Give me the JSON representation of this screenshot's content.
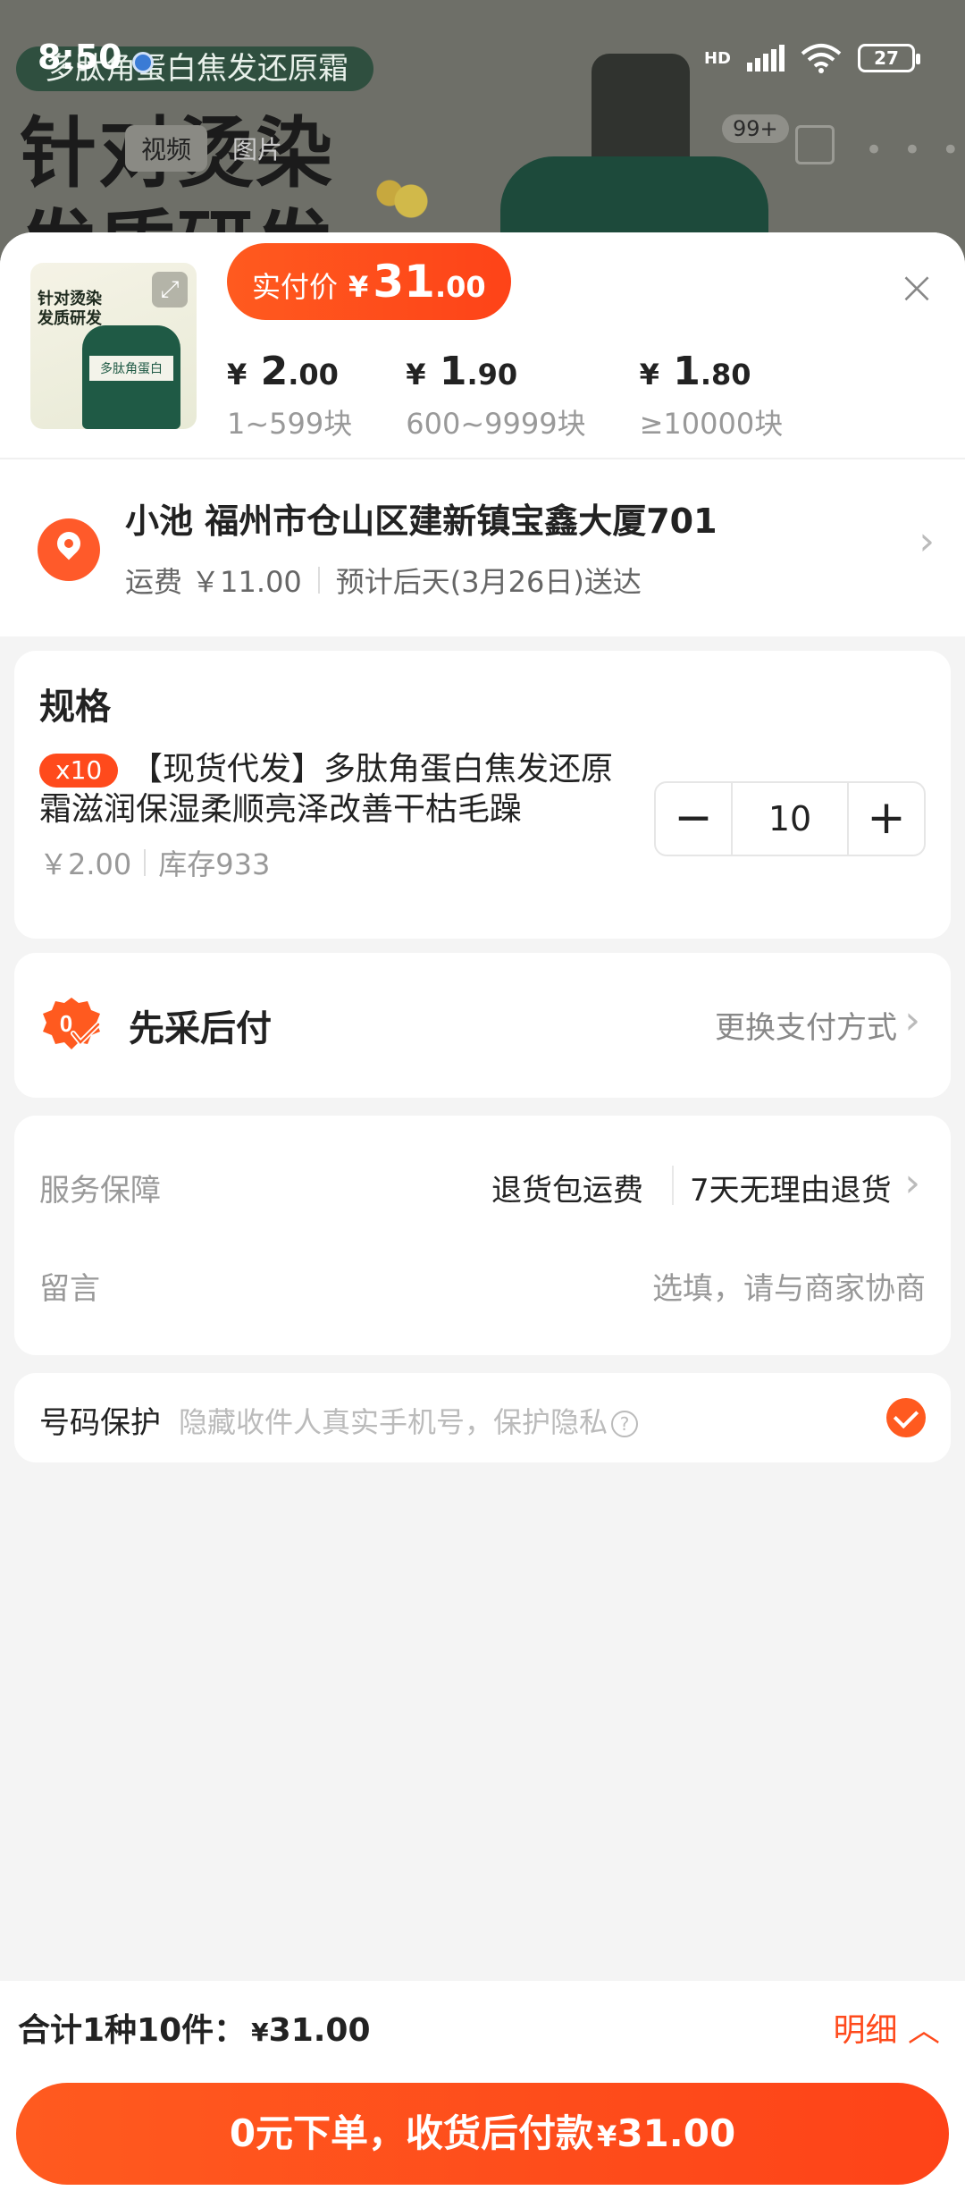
{
  "status": {
    "time": "8:50",
    "network": "HD",
    "battery": "27"
  },
  "background": {
    "banner": "多肽角蛋白焦发还原霜",
    "headline_1": "针对烫染",
    "headline_2": "发质研发",
    "tab_video": "视频",
    "tab_image": "图片",
    "cart_badge": "99+"
  },
  "thumb": {
    "title_1": "针对烫染",
    "title_2": "发质研发",
    "label": "多肽角蛋白"
  },
  "price": {
    "label": "实付价",
    "currency": "¥",
    "amount_int": "31",
    "amount_dec": ".00"
  },
  "tiers": [
    {
      "currency": "¥",
      "int": "2",
      "dec": ".00",
      "range": "1~599块"
    },
    {
      "currency": "¥",
      "int": "1",
      "dec": ".90",
      "range": "600~9999块"
    },
    {
      "currency": "¥",
      "int": "1",
      "dec": ".80",
      "range": "≥10000块"
    }
  ],
  "address": {
    "line": "小池 福州市仓山区建新镇宝鑫大厦701",
    "shipping": "运费 ￥11.00",
    "eta": "预计后天(3月26日)送达"
  },
  "spec": {
    "title": "规格",
    "qty_badge": "x10",
    "name": "【现货代发】多肽角蛋白焦发还原霜滋润保湿柔顺亮泽改善干枯毛躁",
    "unit_price": "￥2.00",
    "stock": "库存933",
    "quantity": "10",
    "minus": "−",
    "plus": "+"
  },
  "payment": {
    "label": "先采后付",
    "change": "更换支付方式"
  },
  "service": {
    "label": "服务保障",
    "value_1": "退货包运费",
    "value_2": "7天无理由退货",
    "message_label": "留言",
    "message_placeholder": "选填，请与商家协商"
  },
  "privacy": {
    "label": "号码保护",
    "desc": "隐藏收件人真实手机号，保护隐私",
    "help": "?"
  },
  "footer": {
    "total_label": "合计1种10件：",
    "total_currency": "¥",
    "total_amount": "31.00",
    "detail": "明细",
    "order_label": "0元下单，收货后付款",
    "order_currency": "¥",
    "order_amount": "31.00"
  },
  "colors": {
    "accent": "#ff5a1f",
    "badge": "#ff4a1c"
  }
}
